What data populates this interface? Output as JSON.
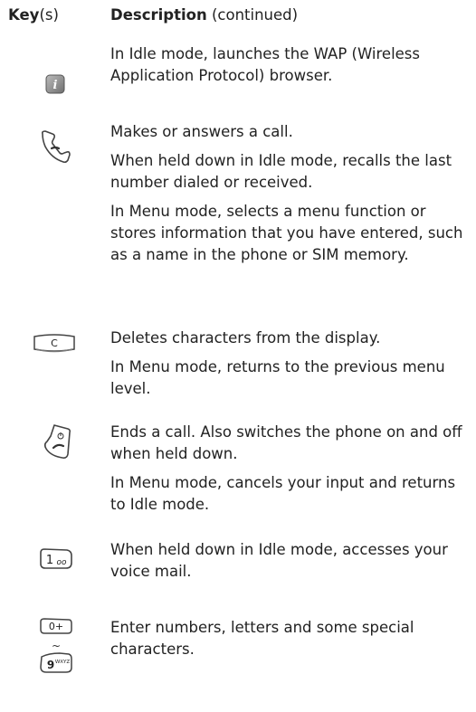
{
  "header": {
    "key_bold": "Key",
    "key_rest": "(s)",
    "desc_bold": "Description",
    "desc_rest": " (continued)"
  },
  "rows": [
    {
      "icon": "wap-info-key-icon",
      "paragraphs": [
        "In Idle mode, launches the WAP (Wireless Application Protocol) browser."
      ]
    },
    {
      "icon": "send-call-key-icon",
      "paragraphs": [
        "Makes or answers a call.",
        "When held down in Idle mode, recalls the last number dialed or received.",
        "In Menu mode, selects a menu function or stores information that you have entered, such as a name in the phone or SIM memory."
      ]
    },
    {
      "icon": "clear-c-key-icon",
      "icon_label": "C",
      "paragraphs": [
        "Deletes characters from the display.",
        "In Menu mode, returns to the previous menu level."
      ]
    },
    {
      "icon": "end-power-key-icon",
      "paragraphs": [
        "Ends a call. Also switches the phone on and off when held down.",
        "In Menu mode, cancels your input and returns to Idle mode."
      ]
    },
    {
      "icon": "voicemail-1-key-icon",
      "icon_label": "1",
      "icon_sub": "oo",
      "paragraphs": [
        "When held down in Idle mode, accesses your voice mail."
      ]
    },
    {
      "icon": "number-keys-range-icon",
      "icon_label_top": "0+",
      "icon_label_mid": "~",
      "icon_label_bottom": "9",
      "icon_sub_bottom": "WXYZ",
      "paragraphs": [
        "Enter numbers, letters and some special characters."
      ]
    }
  ]
}
